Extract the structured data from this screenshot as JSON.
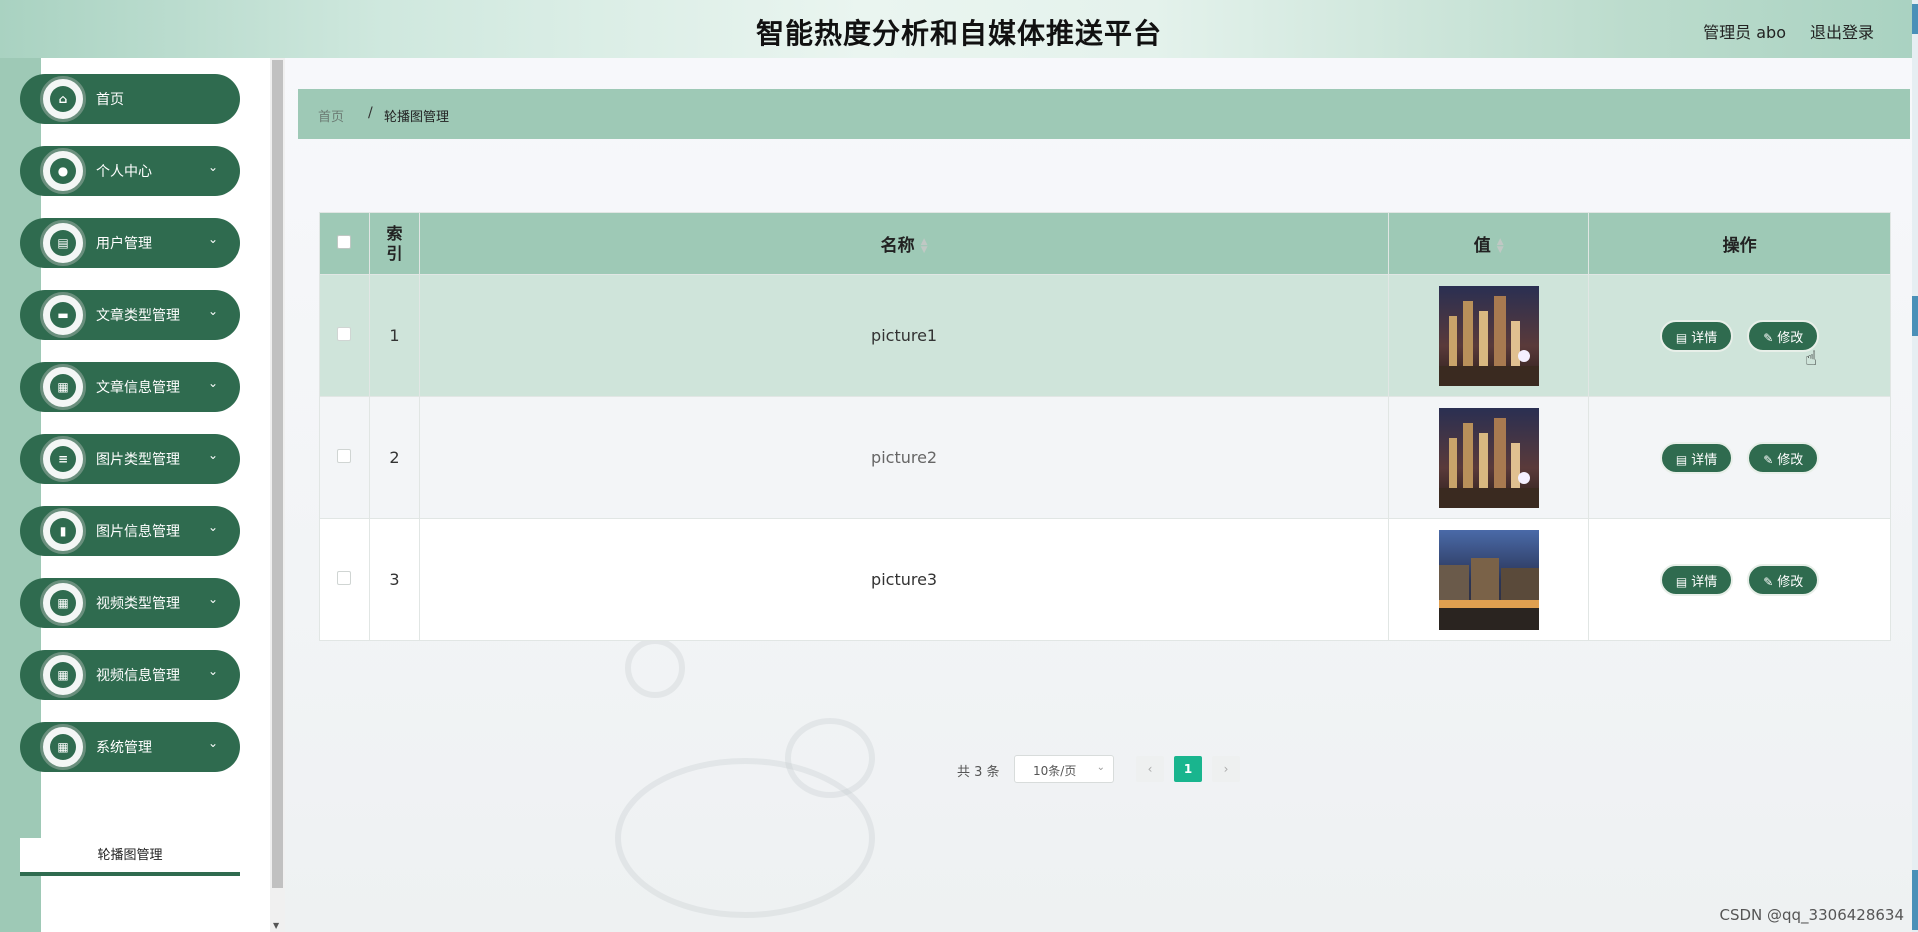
{
  "header": {
    "title": "智能热度分析和自媒体推送平台",
    "user": "管理员 abo",
    "logout": "退出登录"
  },
  "sidebar": {
    "items": [
      {
        "label": "首页",
        "icon": "home-icon",
        "glyph": "⌂",
        "has_children": false
      },
      {
        "label": "个人中心",
        "icon": "user-icon",
        "glyph": "●",
        "has_children": true
      },
      {
        "label": "用户管理",
        "icon": "clipboard-icon",
        "glyph": "▤",
        "has_children": true
      },
      {
        "label": "文章类型管理",
        "icon": "folder-icon",
        "glyph": "▬",
        "has_children": true
      },
      {
        "label": "文章信息管理",
        "icon": "grid-icon",
        "glyph": "▦",
        "has_children": true
      },
      {
        "label": "图片类型管理",
        "icon": "list-icon",
        "glyph": "≡",
        "has_children": true
      },
      {
        "label": "图片信息管理",
        "icon": "bar-chart-icon",
        "glyph": "▮",
        "has_children": true
      },
      {
        "label": "视频类型管理",
        "icon": "grid-icon",
        "glyph": "▦",
        "has_children": true
      },
      {
        "label": "视频信息管理",
        "icon": "grid-icon",
        "glyph": "▦",
        "has_children": true
      },
      {
        "label": "系统管理",
        "icon": "grid-icon",
        "glyph": "▦",
        "has_children": true
      }
    ],
    "submenu": "轮播图管理",
    "chevron": "⌄"
  },
  "breadcrumb": {
    "home": "首页",
    "sep": "/",
    "current": "轮播图管理"
  },
  "table": {
    "headers": {
      "index": "索\n引",
      "index_line1": "索",
      "index_line2": "引",
      "name": "名称",
      "value": "值",
      "action": "操作"
    },
    "rows": [
      {
        "index": "1",
        "name": "picture1"
      },
      {
        "index": "2",
        "name": "picture2"
      },
      {
        "index": "3",
        "name": "picture3"
      }
    ],
    "detail_label": "详情",
    "edit_label": "修改"
  },
  "pager": {
    "total": "共 3 条",
    "page_size": "10条/页",
    "prev": "‹",
    "current": "1",
    "next": "›"
  },
  "watermark": "CSDN @qq_3306428634",
  "colors": {
    "primary": "#2f6b4f",
    "header_band": "#9ec9b6",
    "active_page": "#19b58e"
  }
}
